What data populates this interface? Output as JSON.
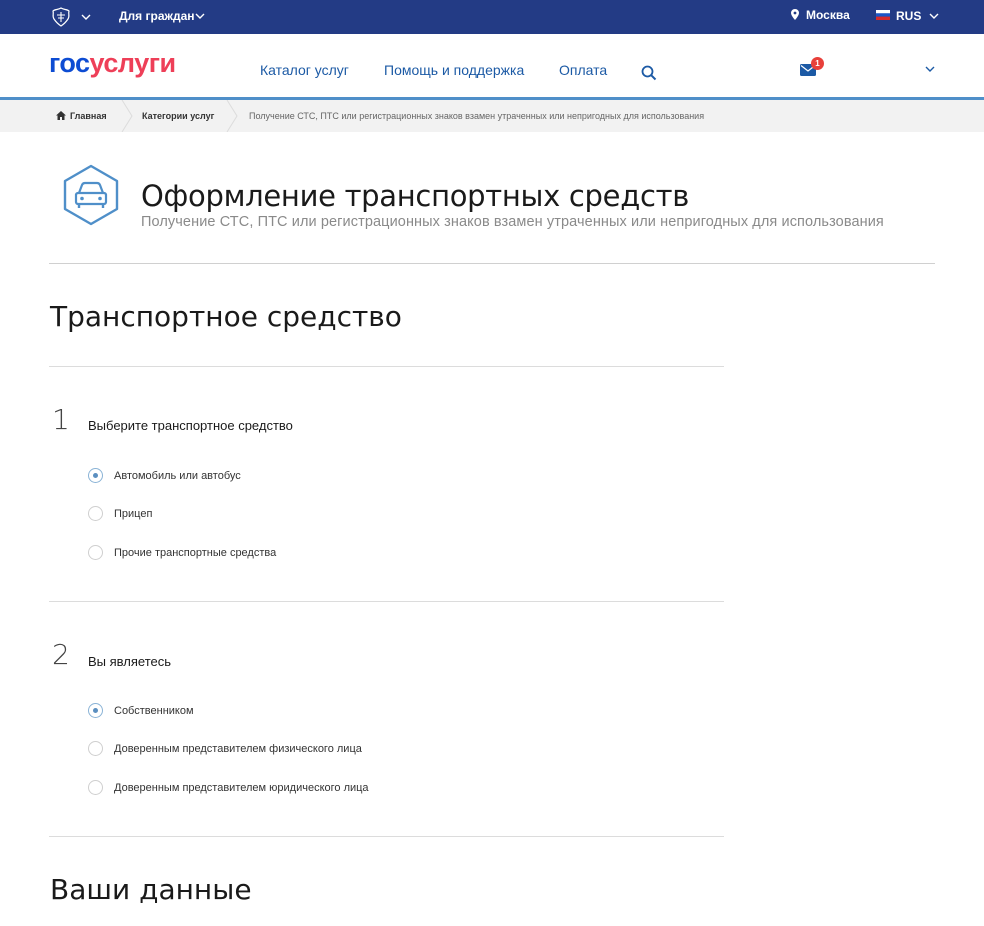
{
  "topbar": {
    "citizens_label": "Для граждан",
    "city": "Москва",
    "language": "RUS",
    "background": "#233b85"
  },
  "header": {
    "logo_part1": "гос",
    "logo_part2": "услуги",
    "nav": [
      "Каталог услуг",
      "Помощь и поддержка",
      "Оплата"
    ],
    "mail_badge": "1",
    "accent": "#1c5aa5"
  },
  "breadcrumbs": {
    "home": "Главная",
    "categories": "Категории услуг",
    "current": "Получение СТС, ПТС или регистрационных знаков взамен утраченных или непригодных для использования"
  },
  "page": {
    "title": "Оформление транспортных средств",
    "subtitle": "Получение СТС, ПТС или регистрационных знаков взамен утраченных или непригодных для использования",
    "icon": "car-icon"
  },
  "sections": {
    "vehicle_heading": "Транспортное средство",
    "your_data_heading": "Ваши данные"
  },
  "steps": [
    {
      "number": "1",
      "question": "Выберите транспортное средство",
      "options": [
        {
          "label": "Автомобиль или автобус",
          "checked": true
        },
        {
          "label": "Прицеп",
          "checked": false
        },
        {
          "label": "Прочие транспортные средства",
          "checked": false
        }
      ]
    },
    {
      "number": "2",
      "question": "Вы являетесь",
      "options": [
        {
          "label": "Собственником",
          "checked": true
        },
        {
          "label": "Доверенным представителем физического лица",
          "checked": false
        },
        {
          "label": "Доверенным представителем юридического лица",
          "checked": false
        }
      ]
    }
  ]
}
